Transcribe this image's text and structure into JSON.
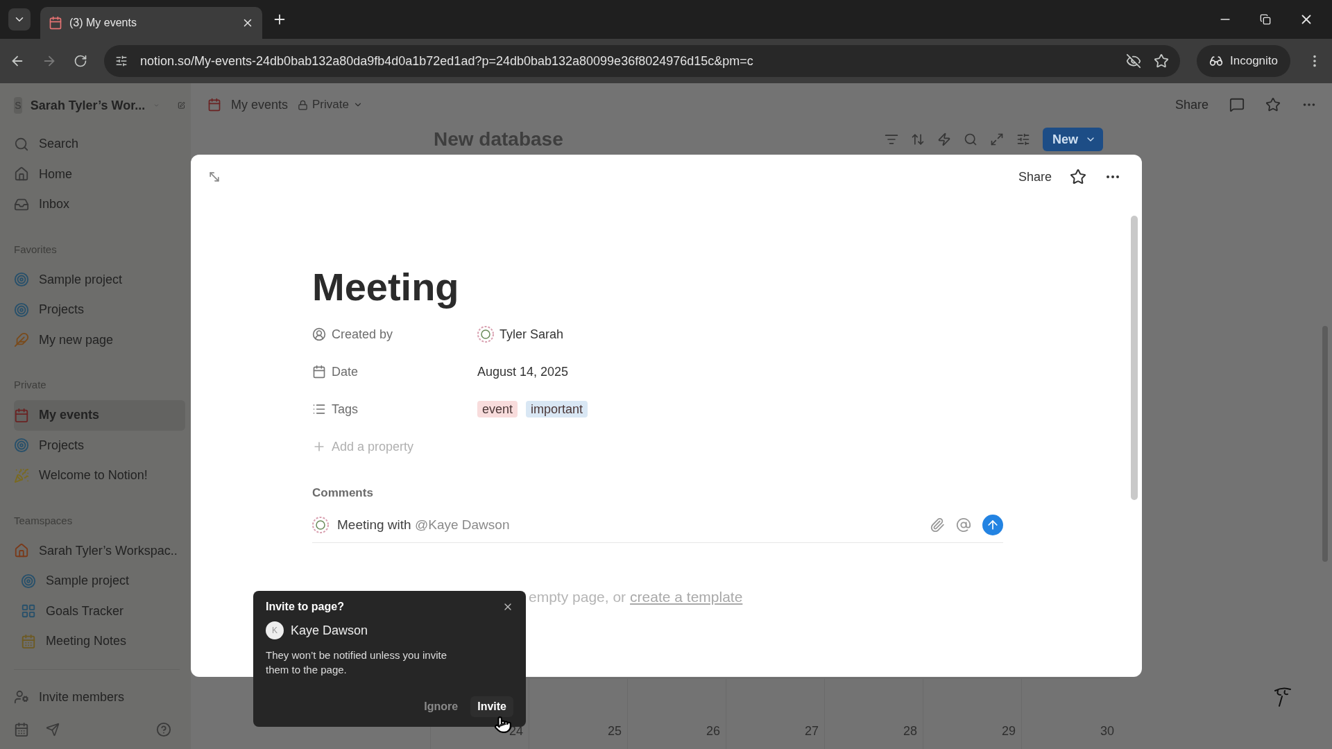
{
  "browser": {
    "tab_title": "(3) My events",
    "url": "notion.so/My-events-24db0bab132a80da9fb4d0a1b72ed1ad?p=24db0bab132a80099e36f8024976d15c&pm=c",
    "incognito_label": "Incognito"
  },
  "sidebar": {
    "workspace_initial": "S",
    "workspace": "Sarah Tyler’s Wor...",
    "nav": [
      {
        "kind": "search",
        "label": "Search"
      },
      {
        "kind": "home",
        "label": "Home"
      },
      {
        "kind": "inbox",
        "label": "Inbox"
      }
    ],
    "sections": [
      {
        "title": "Favorites",
        "items": [
          {
            "kind": "project",
            "label": "Sample project",
            "selected": false
          },
          {
            "kind": "project",
            "label": "Projects",
            "selected": false
          },
          {
            "kind": "note",
            "label": "My new page",
            "selected": false
          }
        ]
      },
      {
        "title": "Private",
        "items": [
          {
            "kind": "calendar",
            "label": "My events",
            "selected": true
          },
          {
            "kind": "project",
            "label": "Projects",
            "selected": false
          },
          {
            "kind": "welcome",
            "label": "Welcome to Notion!",
            "selected": false
          }
        ]
      },
      {
        "title": "Teamspaces",
        "items": [
          {
            "kind": "home",
            "label": "Sarah Tyler’s Workspac..",
            "selected": false,
            "children": [
              {
                "kind": "project",
                "label": "Sample project",
                "selected": false
              },
              {
                "kind": "goals",
                "label": "Goals Tracker",
                "selected": false
              },
              {
                "kind": "meeting",
                "label": "Meeting Notes",
                "selected": false
              }
            ]
          }
        ]
      }
    ],
    "invite": "Invite members"
  },
  "page_header": {
    "breadcrumb": "My events",
    "privacy": "Private",
    "share": "Share"
  },
  "database": {
    "title": "New database",
    "new_button": "New"
  },
  "modal": {
    "share": "Share",
    "title": "Meeting",
    "properties": [
      {
        "kind": "person",
        "label": "Created by",
        "value": "Tyler Sarah"
      },
      {
        "kind": "date",
        "label": "Date",
        "value": "August 14, 2025"
      },
      {
        "kind": "tags",
        "label": "Tags",
        "tags": [
          {
            "label": "event",
            "color": "#f8dcdc"
          },
          {
            "label": "important",
            "color": "#d9e7f4"
          }
        ]
      }
    ],
    "add_property": "Add a property",
    "comments_title": "Comments",
    "comment": {
      "text": "Meeting with",
      "mention": "@Kaye Dawson"
    },
    "hint": {
      "text": "empty page, or",
      "link": "create a template"
    }
  },
  "invite_popup": {
    "title": "Invite to page?",
    "initial": "K",
    "name": "Kaye Dawson",
    "message": "They won’t be notified unless you invite them to the page.",
    "ignore": "Ignore",
    "invite": "Invite"
  },
  "calendar": {
    "days": [
      "24",
      "25",
      "26",
      "27",
      "28",
      "29",
      "30"
    ]
  }
}
